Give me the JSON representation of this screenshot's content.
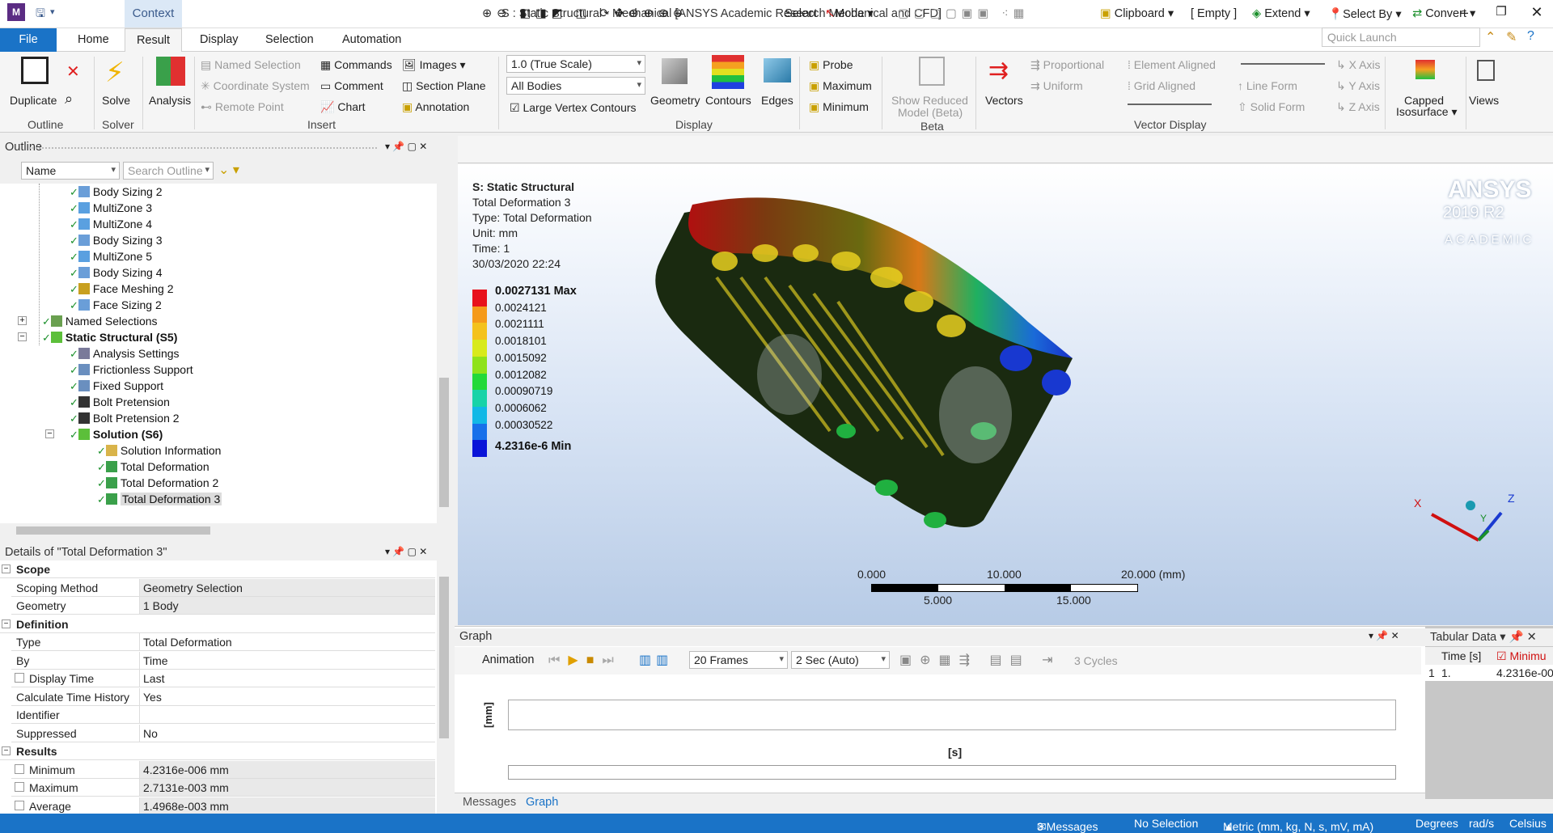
{
  "window": {
    "title": "S : Static Structural - Mechanical [ANSYS Academic Research Mechanical and CFD]",
    "context_tab": "Context",
    "app_icon": "M"
  },
  "tabs": [
    "File",
    "Home",
    "Result",
    "Display",
    "Selection",
    "Automation"
  ],
  "quick_launch_placeholder": "Quick Launch",
  "ribbon": {
    "duplicate": "Duplicate",
    "outline_group": "Outline",
    "solve": "Solve",
    "solver_group": "Solver",
    "analysis": "Analysis",
    "named_selection": "Named Selection",
    "coordinate_system": "Coordinate System",
    "remote_point": "Remote Point",
    "commands": "Commands",
    "comment": "Comment",
    "chart": "Chart",
    "images": "Images",
    "section_plane": "Section Plane",
    "annotation": "Annotation",
    "insert_group": "Insert",
    "scale_combo": "1.0 (True Scale)",
    "bodies_combo": "All Bodies",
    "large_vertex": "Large Vertex Contours",
    "geometry": "Geometry",
    "contours": "Contours",
    "edges": "Edges",
    "display_group": "Display",
    "probe": "Probe",
    "maximum": "Maximum",
    "minimum": "Minimum",
    "show_reduced": "Show Reduced",
    "model_beta": "Model (Beta)",
    "beta_group": "Beta",
    "vectors": "Vectors",
    "proportional": "Proportional",
    "uniform": "Uniform",
    "element_aligned": "Element Aligned",
    "grid_aligned": "Grid Aligned",
    "line_form": "Line Form",
    "solid_form": "Solid Form",
    "x_axis": "X Axis",
    "y_axis": "Y Axis",
    "z_axis": "Z Axis",
    "vector_group": "Vector Display",
    "capped": "Capped",
    "isosurface": "Isosurface",
    "views": "Views"
  },
  "outline": {
    "title": "Outline",
    "name_combo": "Name",
    "search_placeholder": "Search Outline",
    "items": [
      {
        "label": "Body Sizing 2",
        "indent": 4,
        "icon": "#6a9ed8"
      },
      {
        "label": "MultiZone 3",
        "indent": 4,
        "icon": "#5aa0e0"
      },
      {
        "label": "MultiZone 4",
        "indent": 4,
        "icon": "#5aa0e0"
      },
      {
        "label": "Body Sizing 3",
        "indent": 4,
        "icon": "#6a9ed8"
      },
      {
        "label": "MultiZone 5",
        "indent": 4,
        "icon": "#5aa0e0"
      },
      {
        "label": "Body Sizing 4",
        "indent": 4,
        "icon": "#6a9ed8"
      },
      {
        "label": "Face Meshing 2",
        "indent": 4,
        "icon": "#c8a020"
      },
      {
        "label": "Face Sizing 2",
        "indent": 4,
        "icon": "#6a9ed8"
      },
      {
        "label": "Named Selections",
        "indent": 2,
        "icon": "#6aa050",
        "expander": "+"
      },
      {
        "label": "Static Structural (S5)",
        "indent": 2,
        "icon": "#5cbf3a",
        "bold": true,
        "expander": "−"
      },
      {
        "label": "Analysis Settings",
        "indent": 4,
        "icon": "#7a7a9a"
      },
      {
        "label": "Frictionless Support",
        "indent": 4,
        "icon": "#6a8fbf"
      },
      {
        "label": "Fixed Support",
        "indent": 4,
        "icon": "#6a8fbf"
      },
      {
        "label": "Bolt Pretension",
        "indent": 4,
        "icon": "#333"
      },
      {
        "label": "Bolt Pretension 2",
        "indent": 4,
        "icon": "#333"
      },
      {
        "label": "Solution (S6)",
        "indent": 4,
        "icon": "#5cbf3a",
        "bold": true,
        "expander": "−"
      },
      {
        "label": "Solution Information",
        "indent": 6,
        "icon": "#d9b44a"
      },
      {
        "label": "Total Deformation",
        "indent": 6,
        "icon": "#3aa04a"
      },
      {
        "label": "Total Deformation 2",
        "indent": 6,
        "icon": "#3aa04a"
      },
      {
        "label": "Total Deformation 3",
        "indent": 6,
        "icon": "#3aa04a",
        "selected": true
      }
    ]
  },
  "details": {
    "title": "Details of \"Total Deformation 3\"",
    "sections": [
      {
        "name": "Scope",
        "rows": [
          [
            "Scoping Method",
            "Geometry Selection"
          ],
          [
            "Geometry",
            "1 Body"
          ]
        ]
      },
      {
        "name": "Definition",
        "rows": [
          [
            "Type",
            "Total Deformation"
          ],
          [
            "By",
            "Time"
          ],
          [
            "Display Time",
            "Last"
          ],
          [
            "Calculate Time History",
            "Yes"
          ],
          [
            "Identifier",
            ""
          ],
          [
            "Suppressed",
            "No"
          ]
        ]
      },
      {
        "name": "Results",
        "rows": [
          [
            "Minimum",
            "4.2316e-006 mm"
          ],
          [
            "Maximum",
            "2.7131e-003 mm"
          ],
          [
            "Average",
            "1.4968e-003 mm"
          ]
        ]
      }
    ]
  },
  "graphics_toolbar": {
    "select": "Select",
    "mode": "Mode",
    "clipboard": "Clipboard",
    "empty": "[ Empty ]",
    "extend": "Extend",
    "select_by": "Select By",
    "convert": "Convert"
  },
  "viewport": {
    "info": [
      "S: Static Structural",
      "Total Deformation 3",
      "Type: Total Deformation",
      "Unit: mm",
      "Time: 1",
      "30/03/2020 22:24"
    ],
    "legend": [
      {
        "label": "0.0027131 Max",
        "color": "#e8111b",
        "bold": true
      },
      {
        "label": "0.0024121",
        "color": "#f59a1a"
      },
      {
        "label": "0.0021111",
        "color": "#f4c21c"
      },
      {
        "label": "0.0018101",
        "color": "#d8ea1b"
      },
      {
        "label": "0.0015092",
        "color": "#8fe21a"
      },
      {
        "label": "0.0012082",
        "color": "#23d93a"
      },
      {
        "label": "0.00090719",
        "color": "#18d3a8"
      },
      {
        "label": "0.0006062",
        "color": "#12b8e6"
      },
      {
        "label": "0.00030522",
        "color": "#1770ea"
      },
      {
        "label": "4.2316e-6 Min",
        "color": "#0a14d8",
        "bold": true
      }
    ],
    "brand": "ANSYS",
    "version": "2019 R2",
    "edition": "ACADEMIC",
    "scale_labels": [
      "0.000",
      "10.000",
      "20.000 (mm)",
      "5.000",
      "15.000"
    ],
    "axis_labels": [
      "X",
      "Y",
      "Z"
    ]
  },
  "graph": {
    "title": "Graph",
    "animation": "Animation",
    "frames": "20 Frames",
    "time": "2 Sec (Auto)",
    "cycles": "3 Cycles",
    "ylabel": "[mm]",
    "xlabel": "[s]",
    "tabs": [
      "Messages",
      "Graph"
    ]
  },
  "tabular": {
    "title": "Tabular Data",
    "col_time": "Time [s]",
    "col_min": "Minimu",
    "row_index": "1",
    "row_time": "1.",
    "row_min": "4.2316e-00"
  },
  "status": {
    "messages": "3 Messages",
    "selection": "No Selection",
    "units": "Metric (mm, kg, N, s, mV, mA)",
    "degrees": "Degrees",
    "rads": "rad/s",
    "temp": "Celsius"
  }
}
